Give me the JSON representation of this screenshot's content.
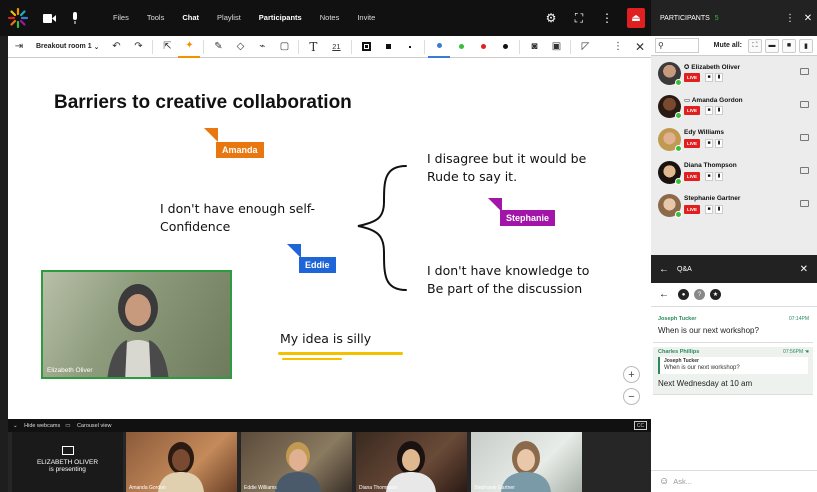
{
  "nav": {
    "links": [
      {
        "label": "Files",
        "active": false
      },
      {
        "label": "Tools",
        "active": false
      },
      {
        "label": "Chat",
        "active": true
      },
      {
        "label": "Playlist",
        "active": false
      },
      {
        "label": "Participants",
        "active": true
      },
      {
        "label": "Notes",
        "active": false
      },
      {
        "label": "Invite",
        "active": false
      }
    ]
  },
  "toolbar": {
    "room": "Breakout room 1",
    "font_size": "21",
    "colors": {
      "blue": "#3a7bd5",
      "green": "#3dbb3d",
      "red": "#e02020",
      "black": "#111111"
    }
  },
  "whiteboard": {
    "title": "Barriers to creative collaboration",
    "notes": [
      "I don't have enough self-\nConfidence",
      "I disagree but it would be\nRude to say it.",
      "I don't have knowledge to\nBe part of the discussion",
      "My idea is silly"
    ],
    "cursors": [
      {
        "name": "Amanda",
        "color": "#e8770f"
      },
      {
        "name": "Stephanie",
        "color": "#a314a8"
      },
      {
        "name": "Eddie",
        "color": "#1e66d8"
      }
    ],
    "video_label": "Elizabeth Oliver"
  },
  "webcams": {
    "hide_label": "Hide webcams",
    "carousel_label": "Carousel view",
    "cc": "CC",
    "presenter_line1": "ELIZABETH OLIVER",
    "presenter_line2": "is presenting",
    "thumbs": [
      "Amanda Gordon",
      "Eddie Williams",
      "Diana Thompson",
      "Stephanie Gartner"
    ]
  },
  "participants": {
    "title": "PARTICIPANTS",
    "count": "5",
    "mute_all": "Mute all:",
    "live": "LIVE",
    "list": [
      "Elizabeth Oliver",
      "Amanda Gordon",
      "Edy Williams",
      "Diana Thompson",
      "Stephanie Gartner"
    ]
  },
  "qa": {
    "title": "Q&A",
    "q1": {
      "name": "Joseph Tucker",
      "time": "07:14PM",
      "text": "When is our next workshop?"
    },
    "q2": {
      "name": "Charles Phillips",
      "time": "07:56PM",
      "quote_name": "Joseph Tucker",
      "quote_text": "When is our next workshop?",
      "text": "Next Wednesday at 10 am"
    },
    "ask_placeholder": "Ask..."
  }
}
